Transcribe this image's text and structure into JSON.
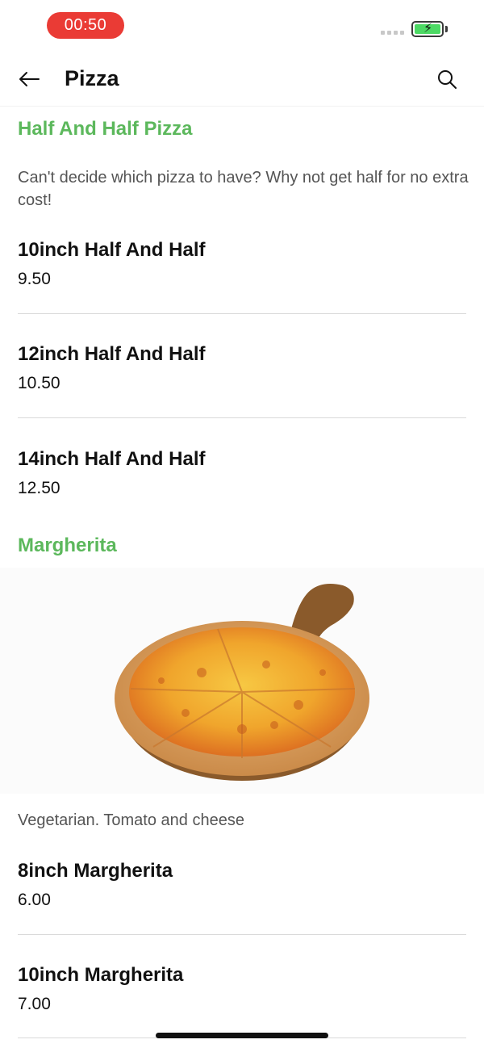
{
  "status": {
    "time": "00:50"
  },
  "header": {
    "title": "Pizza",
    "back_icon": "back-arrow-icon",
    "search_icon": "search-icon"
  },
  "categories": [
    {
      "title": "Half And Half Pizza",
      "description": "Can't decide which pizza to have? Why not get half for no extra cost!",
      "items": [
        {
          "name": "10inch Half And Half",
          "price": "9.50"
        },
        {
          "name": "12inch Half And Half",
          "price": "10.50"
        },
        {
          "name": "14inch Half And Half",
          "price": "12.50"
        }
      ]
    },
    {
      "title": "Margherita",
      "description": "Vegetarian. Tomato and cheese",
      "items": [
        {
          "name": "8inch Margherita",
          "price": "6.00"
        },
        {
          "name": "10inch Margherita",
          "price": "7.00"
        }
      ]
    }
  ],
  "colors": {
    "accent": "#5cb85c",
    "time_pill": "#ea3b35",
    "battery": "#4cd964"
  }
}
